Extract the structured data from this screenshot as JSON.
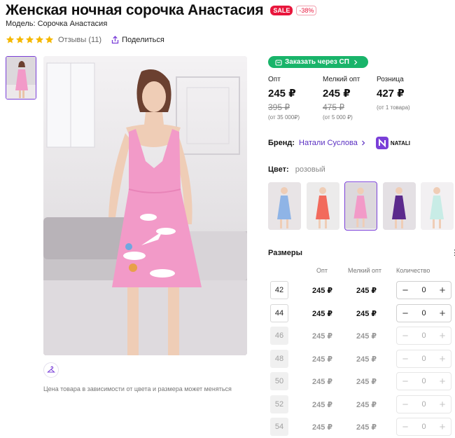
{
  "product": {
    "title": "Женская ночная сорочка Анастасия",
    "sale_badge": "SALE",
    "discount_badge": "-38%",
    "model_text": "Модель: Сорочка Анастасия",
    "rating_stars": 5,
    "reviews_text": "Отзывы (11)",
    "share_text": "Поделиться"
  },
  "gallery": {
    "note": "Цена товара в зависимости от цвета и размера может меняться"
  },
  "order_button": "Заказать через СП",
  "prices": [
    {
      "label": "Опт",
      "current": "245 ₽",
      "old": "395 ₽",
      "sub": "(от 35 000₽)"
    },
    {
      "label": "Мелкий опт",
      "current": "245 ₽",
      "old": "475 ₽",
      "sub": "(от 5 000 ₽)"
    },
    {
      "label": "Розница",
      "current": "427 ₽",
      "old": "",
      "sub": "(от 1 товара)"
    }
  ],
  "brand": {
    "label": "Бренд:",
    "name": "Натали Суслова",
    "logo_text": "NATALI"
  },
  "color": {
    "label": "Цвет:",
    "value": "розовый",
    "swatch_colors": [
      "#8fb4e6",
      "#f26a5c",
      "#f29ac8",
      "#5b2a8c",
      "#c8ece6"
    ],
    "selected_index": 2
  },
  "sizes": {
    "label": "Размеры",
    "more": "⋮",
    "headers": {
      "opt": "Опт",
      "small_opt": "Мелкий опт",
      "qty": "Количество"
    },
    "rows": [
      {
        "size": "42",
        "opt": "245 ₽",
        "small_opt": "245 ₽",
        "qty": "0",
        "available": true
      },
      {
        "size": "44",
        "opt": "245 ₽",
        "small_opt": "245 ₽",
        "qty": "0",
        "available": true
      },
      {
        "size": "46",
        "opt": "245 ₽",
        "small_opt": "245 ₽",
        "qty": "0",
        "available": false
      },
      {
        "size": "48",
        "opt": "245 ₽",
        "small_opt": "245 ₽",
        "qty": "0",
        "available": false
      },
      {
        "size": "50",
        "opt": "245 ₽",
        "small_opt": "245 ₽",
        "qty": "0",
        "available": false
      },
      {
        "size": "52",
        "opt": "245 ₽",
        "small_opt": "245 ₽",
        "qty": "0",
        "available": false
      },
      {
        "size": "54",
        "opt": "245 ₽",
        "small_opt": "245 ₽",
        "qty": "0",
        "available": false
      }
    ],
    "minus": "−",
    "plus": "+"
  },
  "colors": {
    "accent": "#7a3fd8",
    "sale": "#e8163c",
    "order": "#19b46a",
    "star": "#f5b800"
  }
}
